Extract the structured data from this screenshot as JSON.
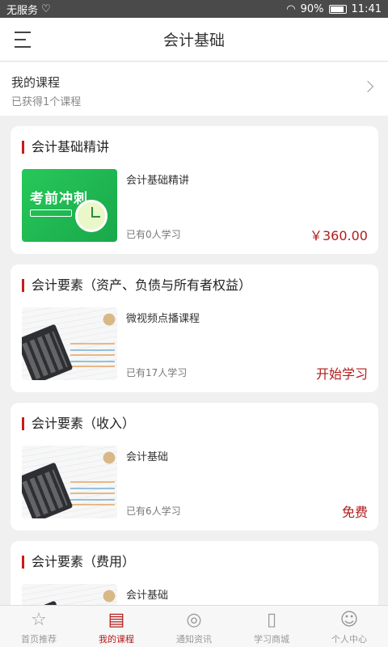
{
  "status": {
    "carrier": "无服务",
    "battery_pct": "90%",
    "time": "11:41"
  },
  "header": {
    "title": "会计基础"
  },
  "my_courses": {
    "title": "我的课程",
    "subtitle": "已获得1个课程"
  },
  "courses": [
    {
      "title": "会计基础精讲",
      "subtitle": "会计基础精讲",
      "learners": "已有0人学习",
      "action": "￥360.00",
      "thumb_text": "考前冲刺"
    },
    {
      "title": "会计要素（资产、负债与所有者权益）",
      "subtitle": "微视频点播课程",
      "learners": "已有17人学习",
      "action": "开始学习"
    },
    {
      "title": "会计要素（收入）",
      "subtitle": "会计基础",
      "learners": "已有6人学习",
      "action": "免费"
    },
    {
      "title": "会计要素（费用）",
      "subtitle": "会计基础",
      "learners": "",
      "action": ""
    }
  ],
  "tabs": [
    {
      "label": "首页推荐",
      "icon": "star-icon"
    },
    {
      "label": "我的课程",
      "icon": "document-icon"
    },
    {
      "label": "通知资讯",
      "icon": "globe-icon"
    },
    {
      "label": "学习商城",
      "icon": "book-icon"
    },
    {
      "label": "个人中心",
      "icon": "person-icon"
    }
  ],
  "colors": {
    "accent": "#b31b1b",
    "status_bar": "#4a4a4a"
  }
}
